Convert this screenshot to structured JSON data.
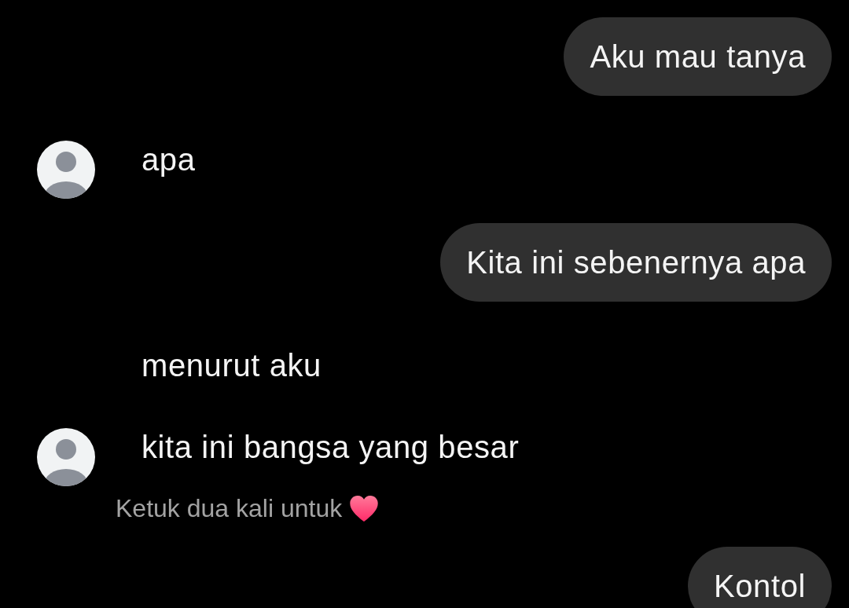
{
  "messages": [
    {
      "kind": "sent",
      "text": "Aku mau tanya"
    },
    {
      "kind": "received",
      "text": "apa",
      "avatar": true
    },
    {
      "kind": "sent",
      "text": "Kita ini sebenernya apa"
    },
    {
      "kind": "received",
      "text": "menurut aku",
      "avatar": false
    },
    {
      "kind": "received",
      "text": "kita ini bangsa yang besar",
      "avatar": true
    },
    {
      "kind": "hint",
      "text": "Ketuk dua kali untuk"
    },
    {
      "kind": "sent",
      "text": "Kontol"
    }
  ]
}
